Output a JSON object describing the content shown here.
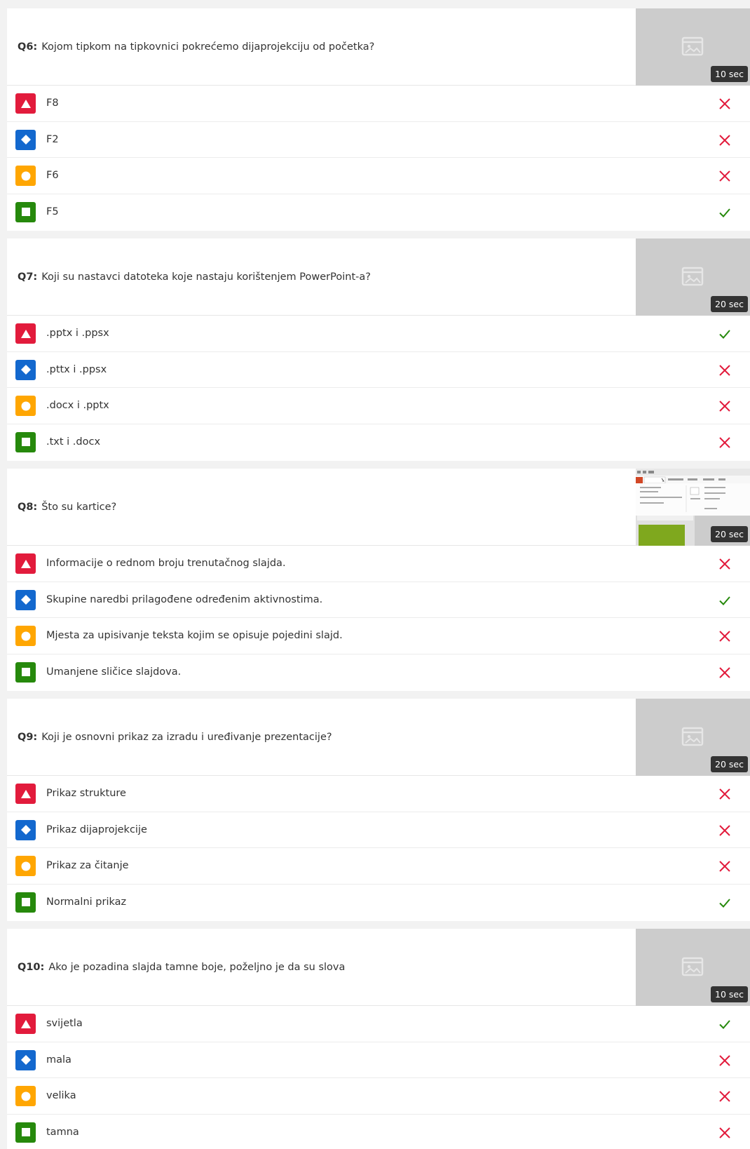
{
  "colors": {
    "triangle": "#e21b3c",
    "diamond": "#1368ce",
    "circle": "#ffa602",
    "square": "#26890c",
    "correct": "#26890c",
    "wrong": "#e21b3c"
  },
  "questions": [
    {
      "number": "Q6:",
      "text": "Kojom tipkom na tipkovnici pokrećemo dijaprojekciju od početka?",
      "time": "10 sec",
      "media": "image-placeholder-icon",
      "answers": [
        {
          "shape": "triangle",
          "text": "F8",
          "correct": false
        },
        {
          "shape": "diamond",
          "text": "F2",
          "correct": false
        },
        {
          "shape": "circle",
          "text": "F6",
          "correct": false
        },
        {
          "shape": "square",
          "text": "F5",
          "correct": true
        }
      ]
    },
    {
      "number": "Q7:",
      "text": "Koji su nastavci datoteka koje nastaju korištenjem PowerPoint-a?",
      "time": "20 sec",
      "media": "image-placeholder-icon",
      "answers": [
        {
          "shape": "triangle",
          "text": ".pptx i .ppsx",
          "correct": true
        },
        {
          "shape": "diamond",
          "text": ".pttx i .ppsx",
          "correct": false
        },
        {
          "shape": "circle",
          "text": ".docx i .pptx",
          "correct": false
        },
        {
          "shape": "square",
          "text": ".txt i .docx",
          "correct": false
        }
      ]
    },
    {
      "number": "Q8:",
      "text": "Što su kartice?",
      "time": "20 sec",
      "media": "ribbon-screenshot-thumbnail",
      "answers": [
        {
          "shape": "triangle",
          "text": "Informacije o rednom broju trenutačnog slajda.",
          "correct": false
        },
        {
          "shape": "diamond",
          "text": "Skupine naredbi prilagođene određenim aktivnostima.",
          "correct": true
        },
        {
          "shape": "circle",
          "text": "Mjesta za upisivanje teksta kojim se opisuje pojedini slajd.",
          "correct": false
        },
        {
          "shape": "square",
          "text": "Umanjene sličice slajdova.",
          "correct": false
        }
      ]
    },
    {
      "number": "Q9:",
      "text": "Koji je osnovni prikaz za izradu i uređivanje prezentacije?",
      "time": "20 sec",
      "media": "image-placeholder-icon",
      "answers": [
        {
          "shape": "triangle",
          "text": "Prikaz strukture",
          "correct": false
        },
        {
          "shape": "diamond",
          "text": "Prikaz dijaprojekcije",
          "correct": false
        },
        {
          "shape": "circle",
          "text": "Prikaz za čitanje",
          "correct": false
        },
        {
          "shape": "square",
          "text": "Normalni prikaz",
          "correct": true
        }
      ]
    },
    {
      "number": "Q10:",
      "text": "Ako je pozadina slajda tamne boje, poželjno je da su slova",
      "time": "10 sec",
      "media": "image-placeholder-icon",
      "answers": [
        {
          "shape": "triangle",
          "text": "svijetla",
          "correct": true
        },
        {
          "shape": "diamond",
          "text": "mala",
          "correct": false
        },
        {
          "shape": "circle",
          "text": "velika",
          "correct": false
        },
        {
          "shape": "square",
          "text": "tamna",
          "correct": false
        }
      ]
    }
  ]
}
